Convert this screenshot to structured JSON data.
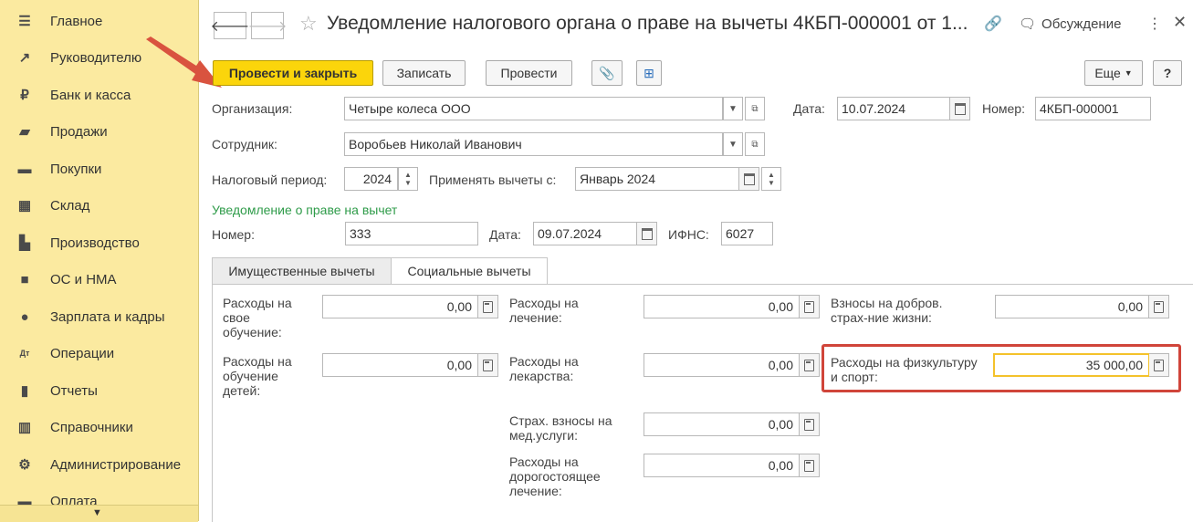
{
  "sidebar": {
    "items": [
      {
        "label": "Главное",
        "icon": "menu-icon"
      },
      {
        "label": "Руководителю",
        "icon": "trend-icon"
      },
      {
        "label": "Банк и касса",
        "icon": "ruble-coin-icon"
      },
      {
        "label": "Продажи",
        "icon": "shopping-bag-icon"
      },
      {
        "label": "Покупки",
        "icon": "shopping-cart-icon"
      },
      {
        "label": "Склад",
        "icon": "warehouse-icon"
      },
      {
        "label": "Производство",
        "icon": "factory-icon"
      },
      {
        "label": "ОС и НМА",
        "icon": "truck-icon"
      },
      {
        "label": "Зарплата и кадры",
        "icon": "person-icon"
      },
      {
        "label": "Операции",
        "icon": "operations-icon"
      },
      {
        "label": "Отчеты",
        "icon": "bar-chart-icon"
      },
      {
        "label": "Справочники",
        "icon": "books-icon"
      },
      {
        "label": "Администрирование",
        "icon": "gear-icon"
      },
      {
        "label": "Оплата",
        "icon": "payment-icon"
      }
    ]
  },
  "header": {
    "title": "Уведомление налогового органа о праве на вычеты 4КБП-000001 от 1...",
    "discussion_label": "Обсуждение"
  },
  "toolbar": {
    "post_close": "Провести и закрыть",
    "save": "Записать",
    "post": "Провести",
    "more": "Еще",
    "help": "?"
  },
  "form": {
    "organization": {
      "label": "Организация:",
      "value": "Четыре колеса ООО"
    },
    "date": {
      "label": "Дата:",
      "value": "10.07.2024"
    },
    "number": {
      "label": "Номер:",
      "value": "4КБП-000001"
    },
    "employee": {
      "label": "Сотрудник:",
      "value": "Воробьев Николай Иванович"
    },
    "tax_period": {
      "label": "Налоговый период:",
      "value": "2024"
    },
    "apply_from": {
      "label": "Применять вычеты с:",
      "value": "Январь 2024"
    },
    "notice_section": "Уведомление о праве на вычет",
    "notice_number": {
      "label": "Номер:",
      "value": "333"
    },
    "notice_date": {
      "label": "Дата:",
      "value": "09.07.2024"
    },
    "ifns": {
      "label": "ИФНС:",
      "value": "6027"
    }
  },
  "tabs": [
    {
      "label": "Имущественные вычеты",
      "active": false
    },
    {
      "label": "Социальные вычеты",
      "active": true
    }
  ],
  "social": {
    "own_education": {
      "label": [
        "Расходы на",
        "свое",
        "обучение:"
      ],
      "value": "0,00"
    },
    "children_education": {
      "label": [
        "Расходы на",
        "обучение",
        "детей:"
      ],
      "value": "0,00"
    },
    "treatment": {
      "label": [
        "Расходы на",
        "лечение:"
      ],
      "value": "0,00"
    },
    "medicines": {
      "label": [
        "Расходы на",
        "лекарства:"
      ],
      "value": "0,00"
    },
    "med_insurance": {
      "label": [
        "Страх. взносы на",
        "мед.услуги:"
      ],
      "value": "0,00"
    },
    "expensive_treatment": {
      "label": [
        "Расходы на",
        "дорогостоящее",
        "лечение:"
      ],
      "value": "0,00"
    },
    "life_insurance": {
      "label": [
        "Взносы на добров.",
        "страх-ние жизни:"
      ],
      "value": "0,00"
    },
    "sport": {
      "label": [
        "Расходы на физкультуру",
        "и спорт:"
      ],
      "value": "35 000,00"
    }
  },
  "colors": {
    "sidebar_bg": "#fbeaa0",
    "primary_button": "#fbd50b",
    "section_title": "#2e9b49",
    "highlight": "#d0453a",
    "arrow": "#d9533f"
  }
}
